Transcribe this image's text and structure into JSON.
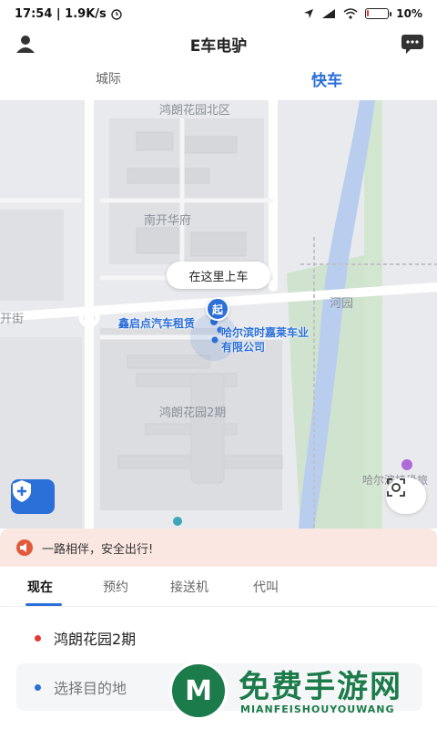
{
  "status": {
    "time_speed": "17:54 | 1.9K/s",
    "battery": "10",
    "battery_level": 0.1
  },
  "header": {
    "title": "E车电驴"
  },
  "mode_tabs": [
    {
      "label": "城际"
    },
    {
      "label": "快车"
    }
  ],
  "map": {
    "labels": {
      "north_district": "鸿朗花园北区",
      "nankai": "南开华府",
      "river_park": "河园",
      "street": "开街",
      "phase2": "鸿朗花园2期",
      "harbin_poi": "哈尔滨桂缘旅"
    },
    "pickup_bubble": "在这里上车",
    "start_pin": "起",
    "poi_1": "鑫启点汽车租赁",
    "poi_2_line1": "哈尔滨时嘉莱车业",
    "poi_2_line2": "有限公司"
  },
  "notice": {
    "text": "一路相伴，安全出行!"
  },
  "service_tabs": [
    {
      "label": "现在"
    },
    {
      "label": "预约"
    },
    {
      "label": "接送机"
    },
    {
      "label": "代叫"
    }
  ],
  "trip": {
    "from": "鸿朗花园2期",
    "to_placeholder": "选择目的地"
  },
  "watermark": {
    "logo_letter": "M",
    "title": "免费手游网",
    "subtitle": "MIANFEISHOUYOUWANG"
  },
  "colors": {
    "accent": "#2b6fd8",
    "notice_bg": "#fbe7e1",
    "watermark": "#1c7b4a"
  }
}
